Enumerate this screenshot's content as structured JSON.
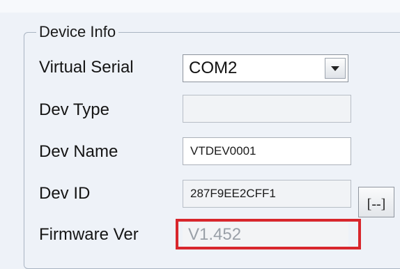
{
  "group": {
    "title": "Device Info"
  },
  "fields": {
    "virtual_serial": {
      "label": "Virtual Serial",
      "value": "COM2"
    },
    "dev_type": {
      "label": "Dev Type",
      "value": ""
    },
    "dev_name": {
      "label": "Dev Name",
      "value": "VTDEV0001"
    },
    "dev_id": {
      "label": "Dev ID",
      "value": "287F9EE2CFF1",
      "button_label": "[--]"
    },
    "firmware_ver": {
      "label": "Firmware Ver",
      "value": "V1.452"
    }
  },
  "colors": {
    "highlight": "#d8262c",
    "background": "#eef2f8"
  }
}
